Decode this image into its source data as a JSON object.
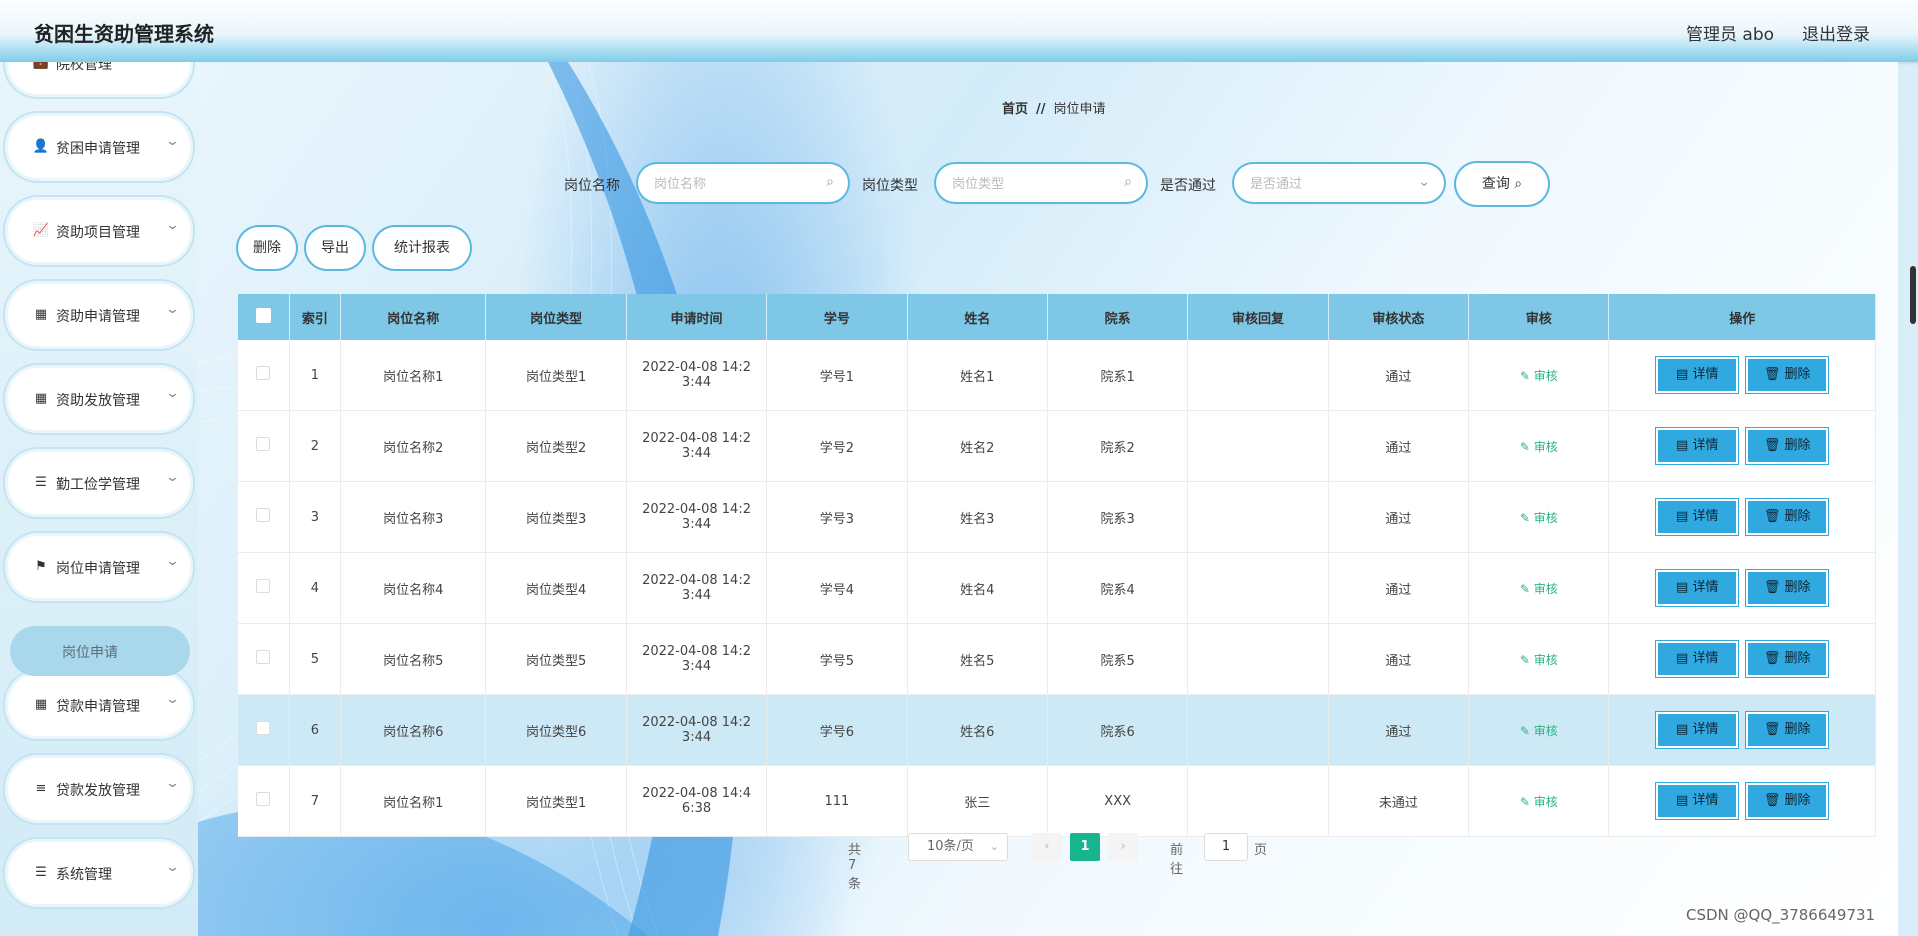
{
  "header": {
    "title": "贫困生资助管理系统",
    "user": "管理员 abo",
    "logout": "退出登录"
  },
  "sidebar": {
    "items": [
      {
        "label": "院校管理",
        "icon": "briefcase-icon",
        "glyph": "💼"
      },
      {
        "label": "贫困申请管理",
        "icon": "user-icon",
        "glyph": "👤"
      },
      {
        "label": "资助项目管理",
        "icon": "chart-icon",
        "glyph": "📈"
      },
      {
        "label": "资助申请管理",
        "icon": "grid-icon",
        "glyph": "▦"
      },
      {
        "label": "资助发放管理",
        "icon": "grid9-icon",
        "glyph": "▦"
      },
      {
        "label": "勤工俭学管理",
        "icon": "list-icon",
        "glyph": "☰"
      },
      {
        "label": "岗位申请管理",
        "icon": "flag-icon",
        "glyph": "⚑"
      },
      {
        "label": "贷款申请管理",
        "icon": "grid-icon",
        "glyph": "▦"
      },
      {
        "label": "贷款发放管理",
        "icon": "sliders-icon",
        "glyph": "≡"
      },
      {
        "label": "系统管理",
        "icon": "list-icon",
        "glyph": "☰"
      }
    ],
    "active_sub": "岗位申请"
  },
  "breadcrumb": {
    "home": "首页",
    "sep": "//",
    "current": "岗位申请"
  },
  "search": {
    "name_label": "岗位名称",
    "name_placeholder": "岗位名称",
    "type_label": "岗位类型",
    "type_placeholder": "岗位类型",
    "pass_label": "是否通过",
    "pass_placeholder": "是否通过",
    "query_label": "查询"
  },
  "actions": {
    "delete": "删除",
    "export": "导出",
    "report": "统计报表"
  },
  "table": {
    "headers": [
      "索引",
      "岗位名称",
      "岗位类型",
      "申请时间",
      "学号",
      "姓名",
      "院系",
      "审核回复",
      "审核状态",
      "审核",
      "操作"
    ],
    "audit_label": "审核",
    "detail_label": "详情",
    "delete_label": "删除",
    "rows": [
      {
        "idx": "1",
        "name": "岗位名称1",
        "type": "岗位类型1",
        "time1": "2022-04-08 14:2",
        "time2": "3:44",
        "sno": "学号1",
        "sname": "姓名1",
        "dept": "院系1",
        "reply": "",
        "status": "通过"
      },
      {
        "idx": "2",
        "name": "岗位名称2",
        "type": "岗位类型2",
        "time1": "2022-04-08 14:2",
        "time2": "3:44",
        "sno": "学号2",
        "sname": "姓名2",
        "dept": "院系2",
        "reply": "",
        "status": "通过"
      },
      {
        "idx": "3",
        "name": "岗位名称3",
        "type": "岗位类型3",
        "time1": "2022-04-08 14:2",
        "time2": "3:44",
        "sno": "学号3",
        "sname": "姓名3",
        "dept": "院系3",
        "reply": "",
        "status": "通过"
      },
      {
        "idx": "4",
        "name": "岗位名称4",
        "type": "岗位类型4",
        "time1": "2022-04-08 14:2",
        "time2": "3:44",
        "sno": "学号4",
        "sname": "姓名4",
        "dept": "院系4",
        "reply": "",
        "status": "通过"
      },
      {
        "idx": "5",
        "name": "岗位名称5",
        "type": "岗位类型5",
        "time1": "2022-04-08 14:2",
        "time2": "3:44",
        "sno": "学号5",
        "sname": "姓名5",
        "dept": "院系5",
        "reply": "",
        "status": "通过"
      },
      {
        "idx": "6",
        "name": "岗位名称6",
        "type": "岗位类型6",
        "time1": "2022-04-08 14:2",
        "time2": "3:44",
        "sno": "学号6",
        "sname": "姓名6",
        "dept": "院系6",
        "reply": "",
        "status": "通过"
      },
      {
        "idx": "7",
        "name": "岗位名称1",
        "type": "岗位类型1",
        "time1": "2022-04-08 14:4",
        "time2": "6:38",
        "sno": "111",
        "sname": "张三",
        "dept": "XXX",
        "reply": "",
        "status": "未通过"
      }
    ],
    "highlighted_row": 6
  },
  "pagination": {
    "total": "共 7 条",
    "page_size": "10条/页",
    "current_page": "1",
    "goto_label": "前往",
    "goto_value": "1",
    "page_suffix": "页"
  },
  "watermark": "CSDN @QQ_3786649731",
  "colors": {
    "header_row": "#7ec7e6",
    "button": "#2fa9e0",
    "pager_active": "#17b58e",
    "audit_link": "#2ab383"
  }
}
